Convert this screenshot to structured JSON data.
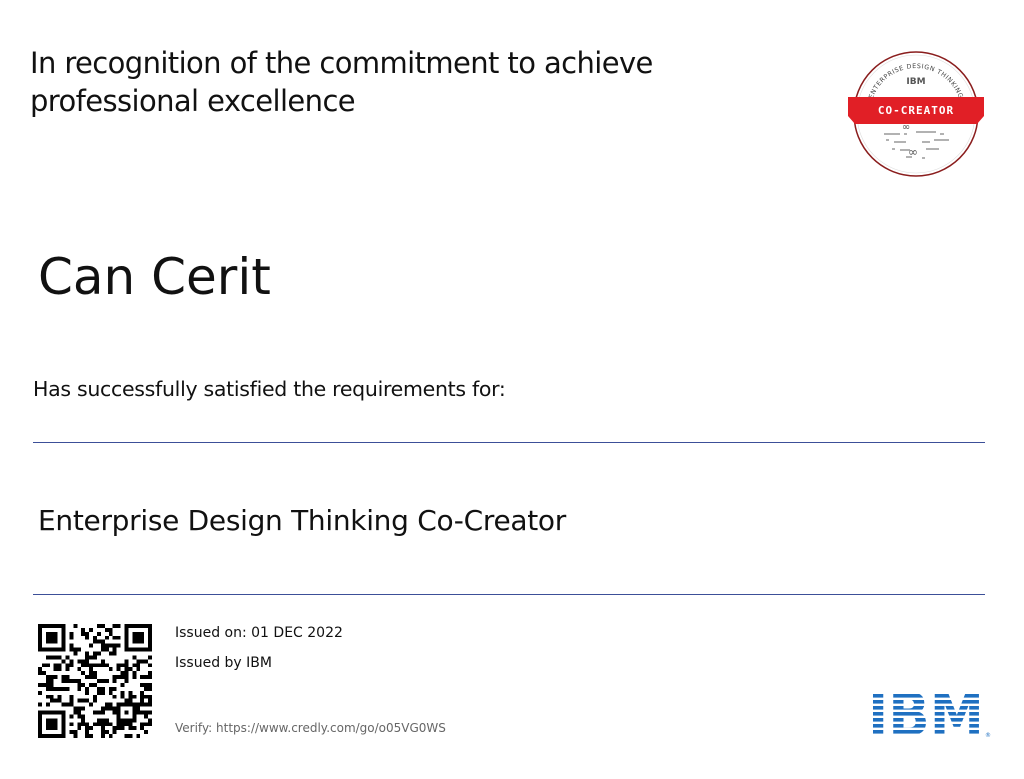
{
  "certificate": {
    "recognition": "In recognition of the commitment to achieve professional excellence",
    "recipient": "Can Cerit",
    "requirements_text": "Has successfully satisfied the requirements for:",
    "credential_name": "Enterprise Design Thinking Co-Creator"
  },
  "issuance": {
    "issued_on": "Issued on: 01 DEC 2022",
    "issued_by": "Issued by IBM",
    "verify": "Verify: https://www.credly.com/go/o05VG0WS"
  },
  "badge": {
    "arc_text": "ENTERPRISE DESIGN THINKING",
    "org": "IBM",
    "ribbon_text": "CO-CREATOR"
  },
  "logo": {
    "text": "IBM"
  },
  "colors": {
    "ribbon_red": "#e11f26",
    "ibm_blue": "#1f70c1",
    "rule_blue": "#3c4f98"
  }
}
